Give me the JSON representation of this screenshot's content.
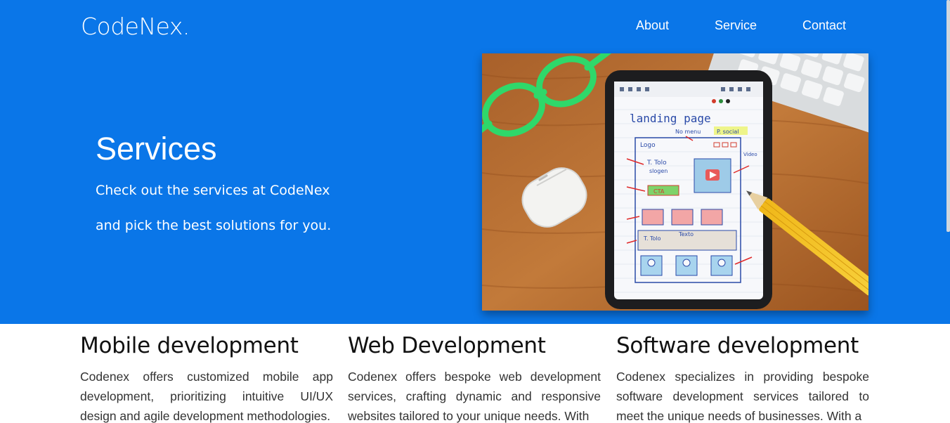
{
  "header": {
    "logo": "CodeNex.",
    "nav": [
      "About",
      "Service",
      "Contact"
    ]
  },
  "hero": {
    "title": "Services",
    "line1": "Check out the services at CodeNex",
    "line2": "and pick the best solutions for you.",
    "image": {
      "screen_title": "landing page",
      "labels": [
        "Logo",
        "No menu",
        "P. social",
        "T. Tolo",
        "slogen",
        "CTA",
        "Video",
        "Texto",
        "T. Tolo"
      ]
    }
  },
  "services": [
    {
      "title": "Mobile development",
      "text": "Codenex offers customized mobile app development, prioritizing intuitive UI/UX design and agile development methodologies."
    },
    {
      "title": "Web Development",
      "text": "Codenex offers bespoke web development services, crafting dynamic and responsive websites tailored to your unique needs. With"
    },
    {
      "title": "Software development",
      "text": "Codenex specializes in providing bespoke software development services tailored to meet the unique needs of businesses. With a"
    }
  ],
  "colors": {
    "hero_bg": "#0a76e8",
    "text_dark": "#111111",
    "text_body": "#333333"
  }
}
